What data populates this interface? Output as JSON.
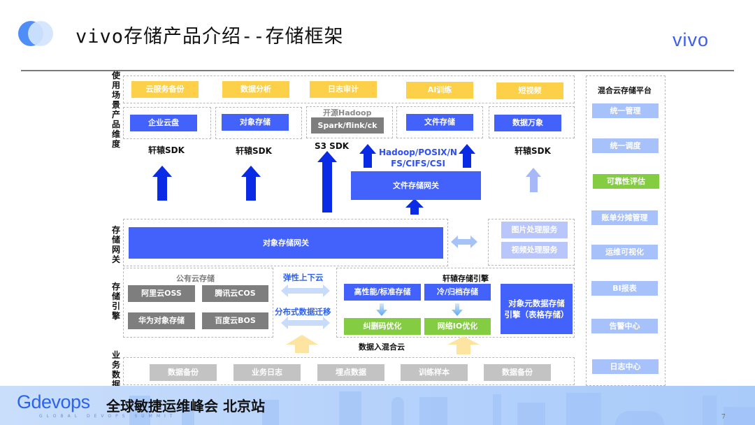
{
  "header": {
    "title": "vivo存储产品介绍--存储框架",
    "brand": "vivo",
    "logo_icon": "two-overlapping-circles"
  },
  "row_labels": {
    "scenarios": "使用场景",
    "products": "产品维度",
    "gateway": "存储网关",
    "engine": "存储引擎",
    "business_data": "业务数据"
  },
  "scenarios": [
    "云服务备份",
    "数据分析",
    "日志审计",
    "AI训练",
    "短视频"
  ],
  "products": [
    {
      "label": "企业云盘",
      "sdk": "轩辕SDK"
    },
    {
      "label": "对象存储",
      "sdk": "轩辕SDK"
    },
    {
      "label": "Spark/flink/ck",
      "caption": "开源Hadoop",
      "sdk": "S3 SDK"
    },
    {
      "label": "文件存储",
      "sdk": ""
    },
    {
      "label": "数据万象",
      "sdk": "轩辕SDK"
    }
  ],
  "file_protocols": "Hadoop/POSIX/NFS/CIFS/CSI",
  "file_protocols_lines": [
    "Hadoop/POSIX/N",
    "FS/CIFS/CSI"
  ],
  "file_gateway": "文件存储网关",
  "object_gateway": "对象存储网关",
  "media_services": [
    "图片处理服务",
    "视频处理服务"
  ],
  "public_cloud": {
    "title": "公有云存储",
    "items": [
      "阿里云OSS",
      "腾讯云COS",
      "华为对象存储",
      "百度云BOS"
    ]
  },
  "migration": {
    "elastic": "弹性上下云",
    "distributed": "分布式数据迁移"
  },
  "xuanyuan_engine": {
    "title": "轩辕存储引擎",
    "tiers": [
      {
        "label": "高性能/标准存储",
        "optimization": "纠删码优化"
      },
      {
        "label": "冷/归档存储",
        "optimization": "网络IO优化"
      }
    ],
    "metadata_engine_lines": [
      "对象元数据存储",
      "引擎（表格存储）"
    ]
  },
  "data_ingest_label": "数据入混合云",
  "business_data": [
    "数据备份",
    "业务日志",
    "埋点数据",
    "训练样本",
    "数据备份"
  ],
  "platform": {
    "title": "混合云存储平台",
    "items": [
      {
        "label": "统一管理",
        "status": "normal"
      },
      {
        "label": "统一调度",
        "status": "normal"
      },
      {
        "label": "可靠性评估",
        "status": "highlight"
      },
      {
        "label": "账单分摊管理",
        "status": "normal"
      },
      {
        "label": "运维可视化",
        "status": "normal"
      },
      {
        "label": "BI报表",
        "status": "normal"
      },
      {
        "label": "告警中心",
        "status": "normal"
      },
      {
        "label": "日志中心",
        "status": "normal"
      }
    ]
  },
  "footer": {
    "brand": "Gdevops",
    "event": "全球敏捷运维峰会  北京站",
    "tagline": "GLOBAL DEVOPS SUMMIT",
    "page_number": "7"
  },
  "colors": {
    "primary_blue": "#4361fb",
    "arrow_blue": "#0a2be6",
    "scenario_yellow": "#fcd049",
    "optimization_green": "#84cc42",
    "brand_blue": "#3d5ef0"
  }
}
